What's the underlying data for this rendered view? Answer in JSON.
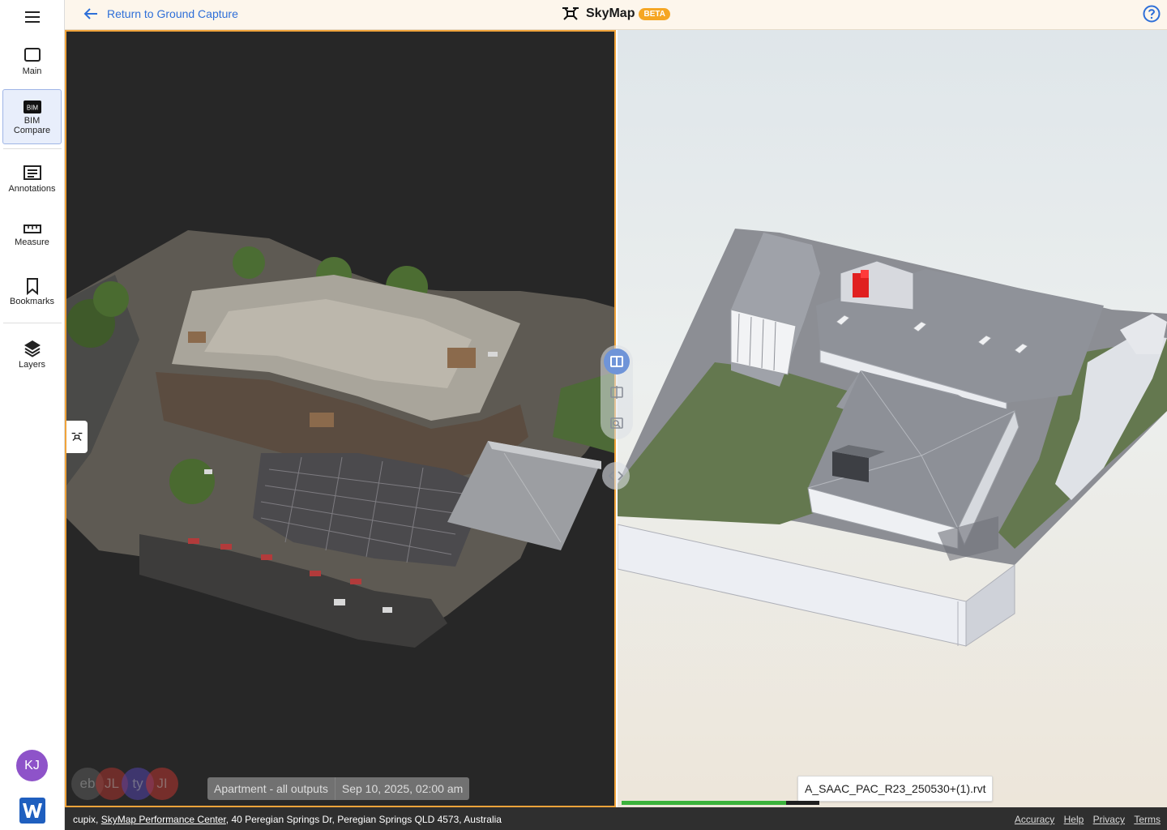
{
  "header": {
    "back_label": "Return to Ground Capture",
    "app_name": "SkyMap",
    "beta_label": "BETA"
  },
  "sidebar": {
    "items": [
      {
        "label": "Main",
        "icon": "square-icon"
      },
      {
        "label": "BIM",
        "label2": "Compare",
        "icon": "bim-icon",
        "icon_text": "BIM",
        "active": true
      },
      {
        "label": "Annotations",
        "icon": "annotations-icon"
      },
      {
        "label": "Measure",
        "icon": "ruler-icon"
      },
      {
        "label": "Bookmarks",
        "icon": "bookmark-icon"
      },
      {
        "label": "Layers",
        "icon": "layers-icon"
      }
    ],
    "user_initials": "KJ"
  },
  "left_viewer": {
    "presence": [
      "eb",
      "JL",
      "ty",
      "JI"
    ],
    "capture_name": "Apartment - all outputs",
    "capture_date": "Sep 10, 2025, 02:00 am"
  },
  "right_viewer": {
    "model_file": "A_SAAC_PAC_R23_250530+(1).rvt",
    "load_progress": 0.83
  },
  "footer": {
    "company": "cupix,",
    "project_link": "SkyMap Performance Center",
    "address": ", 40 Peregian Springs Dr, Peregian Springs QLD 4573, Australia",
    "links": [
      "Accuracy",
      "Help",
      "Privacy",
      "Terms"
    ]
  },
  "colors": {
    "accent_orange": "#f0a33a",
    "link_blue": "#2e6fd8",
    "progress_green": "#3bb23b",
    "avatar_purple": "#8e53c9"
  }
}
